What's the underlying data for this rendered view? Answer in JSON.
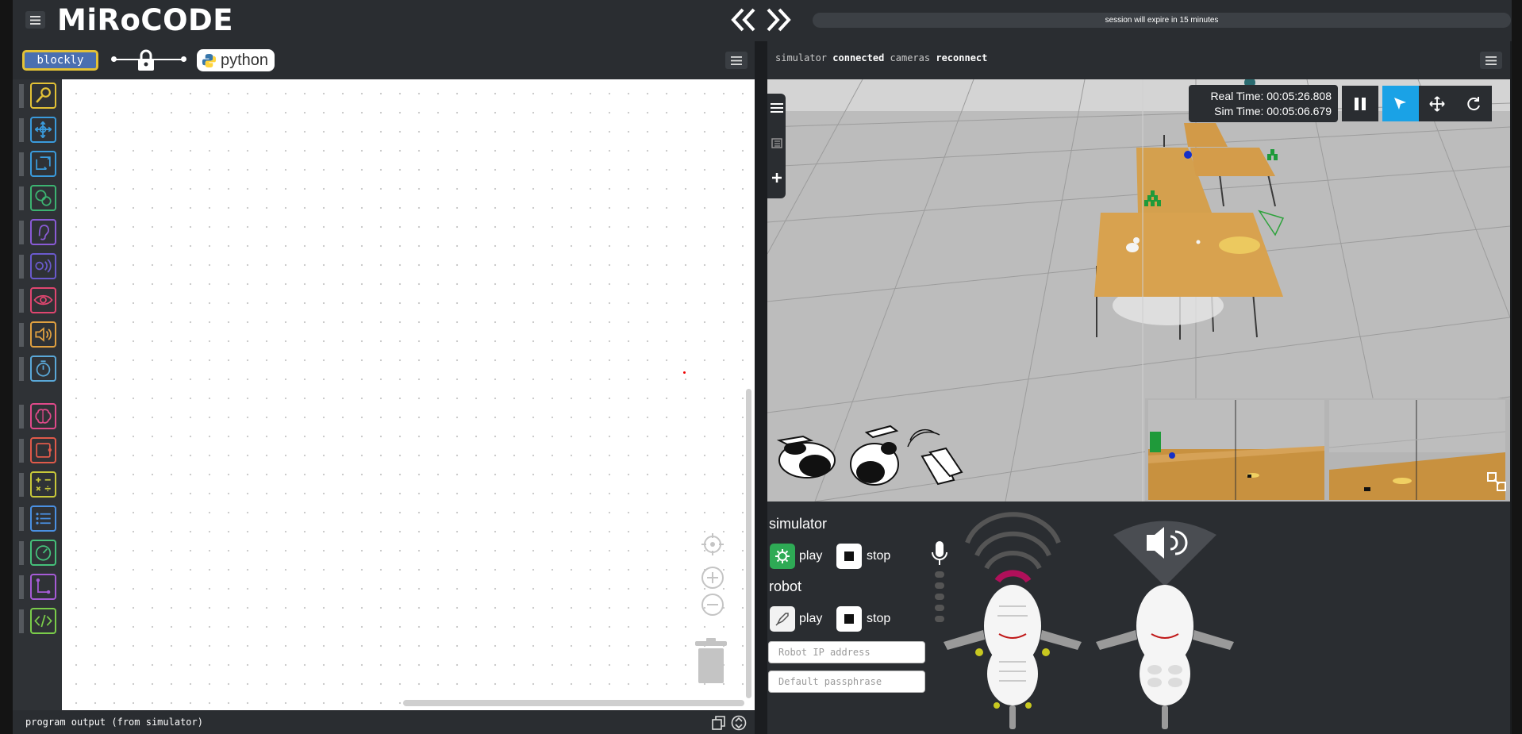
{
  "app": {
    "logo": "MiRoCODE",
    "session_notice": "session will expire in 15 minutes"
  },
  "editor": {
    "mode_blockly": "blockly",
    "mode_python": "python",
    "lock_state": "locked",
    "output_label": "program output (from simulator)"
  },
  "toolbox": {
    "categories": [
      {
        "icon": "magnifier-icon",
        "color": "#e3c236"
      },
      {
        "icon": "move-arrows-icon",
        "color": "#3a9bdc"
      },
      {
        "icon": "rotate-arrows-icon",
        "color": "#3a9bdc"
      },
      {
        "icon": "faces-icon",
        "color": "#3cb371"
      },
      {
        "icon": "ear-icon",
        "color": "#8a5bd6"
      },
      {
        "icon": "broadcast-icon",
        "color": "#6a5acd"
      },
      {
        "icon": "eye-icon",
        "color": "#e04670"
      },
      {
        "icon": "speaker-icon",
        "color": "#e0a040"
      },
      {
        "icon": "timer-icon",
        "color": "#5aa8d8"
      },
      {
        "icon": "brain-icon",
        "color": "#e04a8a"
      },
      {
        "icon": "loop-icon",
        "color": "#e05a4a"
      },
      {
        "icon": "math-icon",
        "color": "#c8c83a"
      },
      {
        "icon": "list-icon",
        "color": "#4a90e2"
      },
      {
        "icon": "gauge-icon",
        "color": "#45c07a"
      },
      {
        "icon": "path-icon",
        "color": "#a65bd6"
      },
      {
        "icon": "code-icon",
        "color": "#7acc4a"
      }
    ]
  },
  "simulator_header": {
    "simulator_label": "simulator",
    "simulator_status": "connected",
    "cameras_label": "cameras",
    "cameras_action": "reconnect"
  },
  "sim": {
    "real_time_label": "Real Time:",
    "real_time": "00:05:26.808",
    "sim_time_label": "Sim Time:",
    "sim_time": "00:05:06.679"
  },
  "controls": {
    "simulator_title": "simulator",
    "robot_title": "robot",
    "play_label": "play",
    "stop_label": "stop",
    "robot_ip_placeholder": "Robot IP address",
    "passphrase_placeholder": "Default passphrase"
  },
  "colors": {
    "accent": "#1aa2e6",
    "play_green": "#2eaa55",
    "panel": "#2a2d31"
  }
}
